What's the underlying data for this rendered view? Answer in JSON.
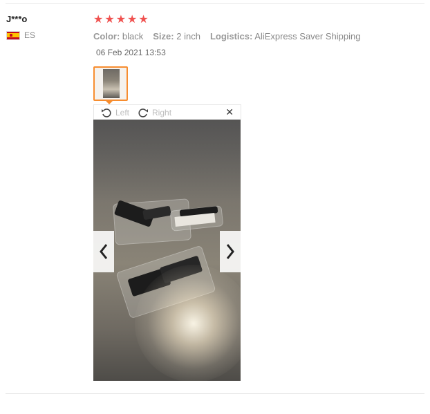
{
  "review": {
    "user": {
      "name": "J***o",
      "country_code": "ES",
      "flag": "spain-flag"
    },
    "rating": {
      "stars": 5,
      "max": 5,
      "color": "#f0514f"
    },
    "specs": [
      {
        "label": "Color:",
        "value": "black"
      },
      {
        "label": "Size:",
        "value": "2 inch"
      },
      {
        "label": "Logistics:",
        "value": "AliExpress Saver Shipping"
      }
    ],
    "date": "06 Feb 2021 13:53"
  },
  "viewer": {
    "rotate_left_label": "Left",
    "rotate_right_label": "Right",
    "close_icon": "close-icon",
    "prev_icon": "chevron-left-icon",
    "next_icon": "chevron-right-icon",
    "accent_color": "#f78d2f"
  }
}
